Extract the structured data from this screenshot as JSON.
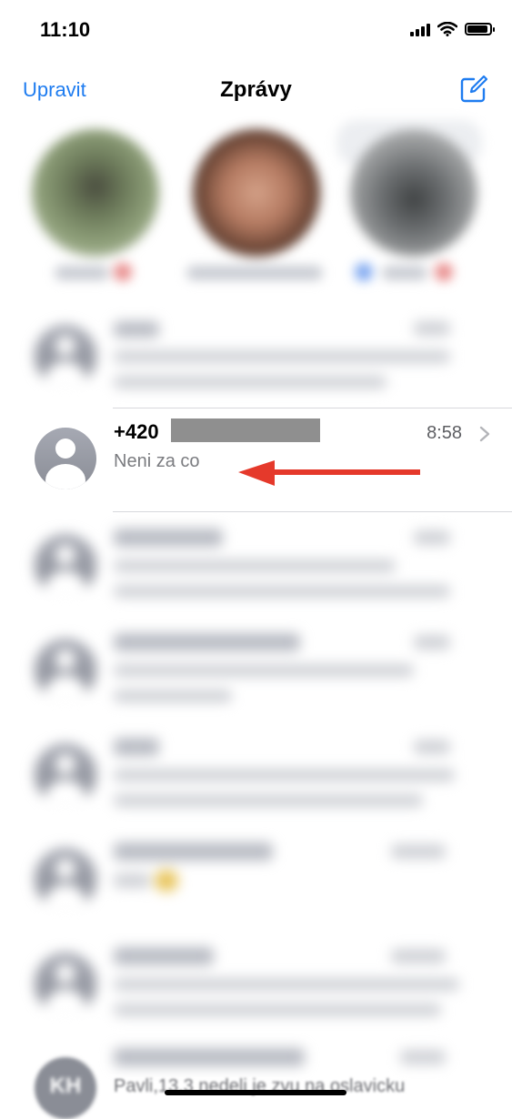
{
  "status_bar": {
    "time": "11:10",
    "icons": [
      "signal-icon",
      "wifi-icon",
      "battery-icon"
    ]
  },
  "nav": {
    "edit_label": "Upravit",
    "title": "Zprávy",
    "compose_icon": "compose-icon"
  },
  "colors": {
    "accent": "#1e7cf0",
    "arrow": "#e5392b",
    "redaction": "#8f8f8f"
  },
  "focused_conversation": {
    "name_prefix": "+420",
    "time": "8:58",
    "preview": "Neni za co"
  },
  "bottom_preview": {
    "initials": "KH",
    "text": "Pavli,13.3 nedeli je zvu na oslavicku"
  }
}
